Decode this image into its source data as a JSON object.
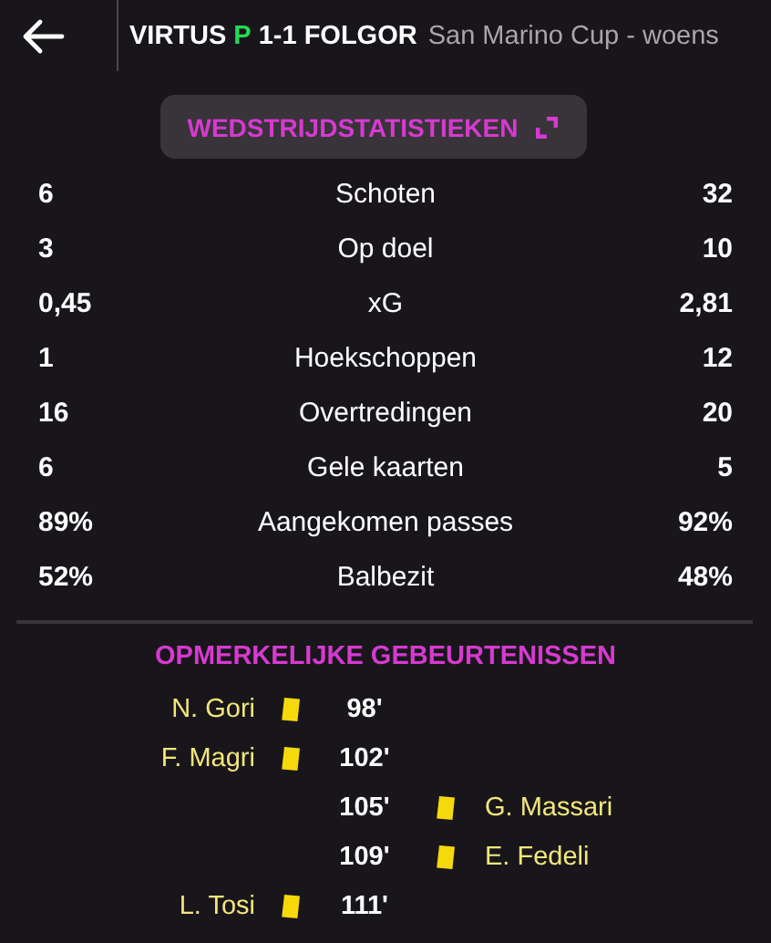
{
  "header": {
    "home_team": "VIRTUS",
    "penalty_marker": "P",
    "score": "1-1",
    "away_team": "FOLGOR",
    "competition": "San Marino Cup - woens"
  },
  "stats_button": {
    "label": "WEDSTRIJDSTATISTIEKEN"
  },
  "stats": [
    {
      "home": "6",
      "label": "Schoten",
      "away": "32"
    },
    {
      "home": "3",
      "label": "Op doel",
      "away": "10"
    },
    {
      "home": "0,45",
      "label": "xG",
      "away": "2,81"
    },
    {
      "home": "1",
      "label": "Hoekschoppen",
      "away": "12"
    },
    {
      "home": "16",
      "label": "Overtredingen",
      "away": "20"
    },
    {
      "home": "6",
      "label": "Gele kaarten",
      "away": "5"
    },
    {
      "home": "89%",
      "label": "Aangekomen passes",
      "away": "92%"
    },
    {
      "home": "52%",
      "label": "Balbezit",
      "away": "48%"
    }
  ],
  "events_title": "OPMERKELIJKE GEBEURTENISSEN",
  "events": [
    {
      "away": false,
      "kind": "yellow_card",
      "player": "N. Gori",
      "minute": "98'"
    },
    {
      "away": false,
      "kind": "yellow_card",
      "player": "F. Magri",
      "minute": "102'"
    },
    {
      "away": true,
      "kind": "yellow_card",
      "player": "G. Massari",
      "minute": "105'"
    },
    {
      "away": true,
      "kind": "yellow_card",
      "player": "E. Fedeli",
      "minute": "109'"
    },
    {
      "away": false,
      "kind": "yellow_card",
      "player": "L. Tosi",
      "minute": "111'"
    }
  ]
}
